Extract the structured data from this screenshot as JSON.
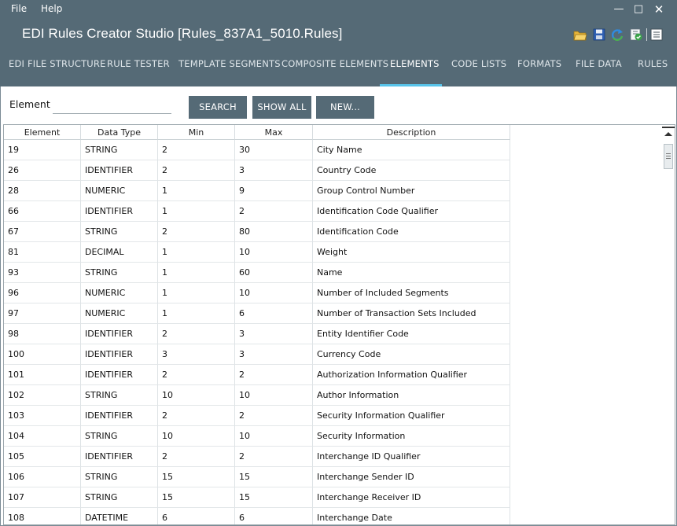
{
  "menu": {
    "file": "File",
    "help": "Help"
  },
  "window": {
    "minimize": "—",
    "maximize": "□",
    "close": "✕"
  },
  "app": {
    "title": "EDI Rules Creator Studio [Rules_837A1_5010.Rules]"
  },
  "toolbar": {
    "icons": [
      "folder-open-icon",
      "save-icon",
      "refresh-icon",
      "validate-icon",
      "notes-icon"
    ]
  },
  "tabs": [
    {
      "label": "EDI FILE STRUCTURE",
      "active": false
    },
    {
      "label": "RULE TESTER",
      "active": false
    },
    {
      "label": "TEMPLATE SEGMENTS",
      "active": false
    },
    {
      "label": "COMPOSITE ELEMENTS",
      "active": false
    },
    {
      "label": "ELEMENTS",
      "active": true
    },
    {
      "label": "CODE LISTS",
      "active": false
    },
    {
      "label": "FORMATS",
      "active": false
    },
    {
      "label": "FILE DATA",
      "active": false
    },
    {
      "label": "RULES",
      "active": false
    }
  ],
  "filter": {
    "label": "Element",
    "value": "",
    "placeholder": ""
  },
  "buttons": {
    "search": "SEARCH",
    "show_all": "SHOW ALL",
    "new": "NEW..."
  },
  "colors": {
    "chrome": "#556a76",
    "accent": "#58c4ea"
  },
  "table": {
    "columns": [
      "Element",
      "Data Type",
      "Min",
      "Max",
      "Description"
    ],
    "rows": [
      [
        "19",
        "STRING",
        "2",
        "30",
        "City Name"
      ],
      [
        "26",
        "IDENTIFIER",
        "2",
        "3",
        "Country Code"
      ],
      [
        "28",
        "NUMERIC",
        "1",
        "9",
        "Group Control Number"
      ],
      [
        "66",
        "IDENTIFIER",
        "1",
        "2",
        "Identification Code Qualifier"
      ],
      [
        "67",
        "STRING",
        "2",
        "80",
        "Identification Code"
      ],
      [
        "81",
        "DECIMAL",
        "1",
        "10",
        "Weight"
      ],
      [
        "93",
        "STRING",
        "1",
        "60",
        "Name"
      ],
      [
        "96",
        "NUMERIC",
        "1",
        "10",
        "Number of Included Segments"
      ],
      [
        "97",
        "NUMERIC",
        "1",
        "6",
        "Number of Transaction Sets Included"
      ],
      [
        "98",
        "IDENTIFIER",
        "2",
        "3",
        "Entity Identifier Code"
      ],
      [
        "100",
        "IDENTIFIER",
        "3",
        "3",
        "Currency Code"
      ],
      [
        "101",
        "IDENTIFIER",
        "2",
        "2",
        "Authorization Information Qualifier"
      ],
      [
        "102",
        "STRING",
        "10",
        "10",
        "Author Information"
      ],
      [
        "103",
        "IDENTIFIER",
        "2",
        "2",
        "Security Information Qualifier"
      ],
      [
        "104",
        "STRING",
        "10",
        "10",
        "Security Information"
      ],
      [
        "105",
        "IDENTIFIER",
        "2",
        "2",
        "Interchange ID Qualifier"
      ],
      [
        "106",
        "STRING",
        "15",
        "15",
        "Interchange Sender ID"
      ],
      [
        "107",
        "STRING",
        "15",
        "15",
        "Interchange Receiver ID"
      ],
      [
        "108",
        "DATETIME",
        "6",
        "6",
        "Interchange Date"
      ]
    ]
  }
}
